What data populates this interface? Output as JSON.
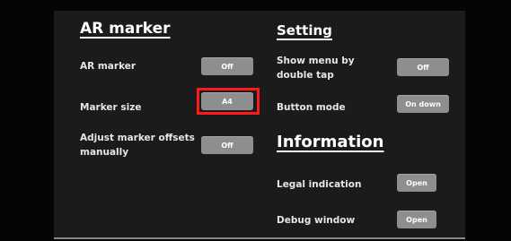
{
  "ar_marker_section": {
    "heading": "AR marker",
    "ar_marker_label": "AR marker",
    "ar_marker_value": "Off",
    "marker_size_label": "Marker size",
    "marker_size_value": "A4",
    "adjust_offsets_label_line1": "Adjust marker offsets",
    "adjust_offsets_label_line2": "manually",
    "adjust_offsets_value": "Off"
  },
  "setting_section": {
    "heading": "Setting",
    "show_menu_label_line1": "Show menu by",
    "show_menu_label_line2": "double tap",
    "show_menu_value": "Off",
    "button_mode_label": "Button mode",
    "button_mode_value": "On down"
  },
  "information_section": {
    "heading": "Information",
    "legal_label": "Legal indication",
    "legal_button": "Open",
    "debug_label": "Debug window",
    "debug_button": "Open"
  },
  "colors": {
    "background": "#1b1b1b",
    "button": "#8e8e8e",
    "highlight": "#ff1a1a"
  }
}
